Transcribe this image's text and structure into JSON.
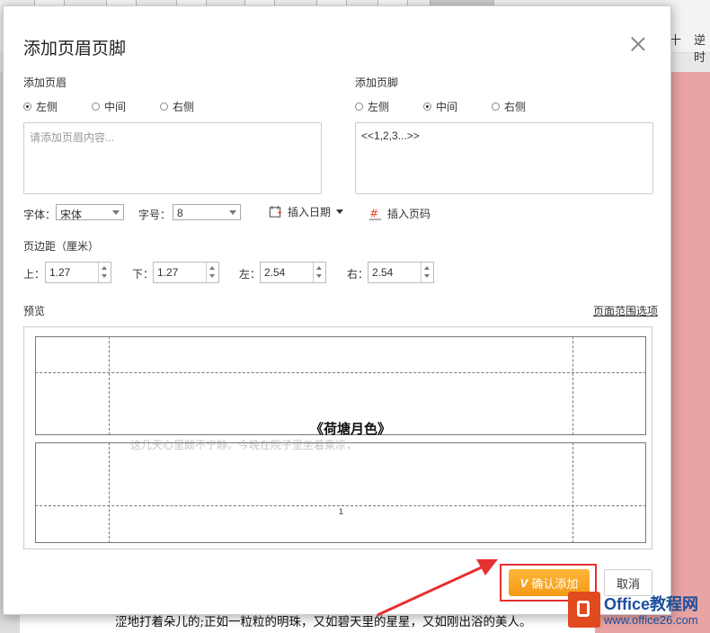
{
  "background": {
    "right_text_1": "十",
    "right_text_2": "逆时",
    "doc_text": "涩地打着朵儿的;正如一粒粒的明珠，又如碧天里的星星，又如刚出浴的美人。"
  },
  "dialog": {
    "title": "添加页眉页脚",
    "header": {
      "label": "添加页眉",
      "align_options": [
        "左侧",
        "中间",
        "右侧"
      ],
      "selected": "左侧",
      "placeholder": "请添加页眉内容..."
    },
    "footer": {
      "label": "添加页脚",
      "align_options": [
        "左侧",
        "中间",
        "右侧"
      ],
      "selected": "中间",
      "value": "<<1,2,3...>>"
    },
    "font": {
      "label": "字体：",
      "value": "宋体"
    },
    "size": {
      "label": "字号：",
      "value": "8"
    },
    "insert_date_label": "插入日期",
    "insert_page_label": "插入页码",
    "margins": {
      "label": "页边距（厘米）",
      "top": {
        "label": "上：",
        "value": "1.27"
      },
      "bottom": {
        "label": "下：",
        "value": "1.27"
      },
      "left": {
        "label": "左：",
        "value": "2.54"
      },
      "right": {
        "label": "右：",
        "value": "2.54"
      }
    },
    "preview": {
      "label": "预览",
      "range_link": "页面范围选项",
      "title_text": "《荷塘月色》",
      "faint_text": "这几天心里颇不宁静。今晚在院子里坐着乘凉，",
      "footer_mark": "1"
    },
    "confirm_label": "确认添加",
    "confirm_badge": "V",
    "cancel_label": "取消"
  },
  "watermark": {
    "line1": "Office教程网",
    "line2": "www.office26.com"
  },
  "colors": {
    "accent": "#f39a16",
    "highlight": "#e53030",
    "doc_bg": "#e8a3a3"
  }
}
